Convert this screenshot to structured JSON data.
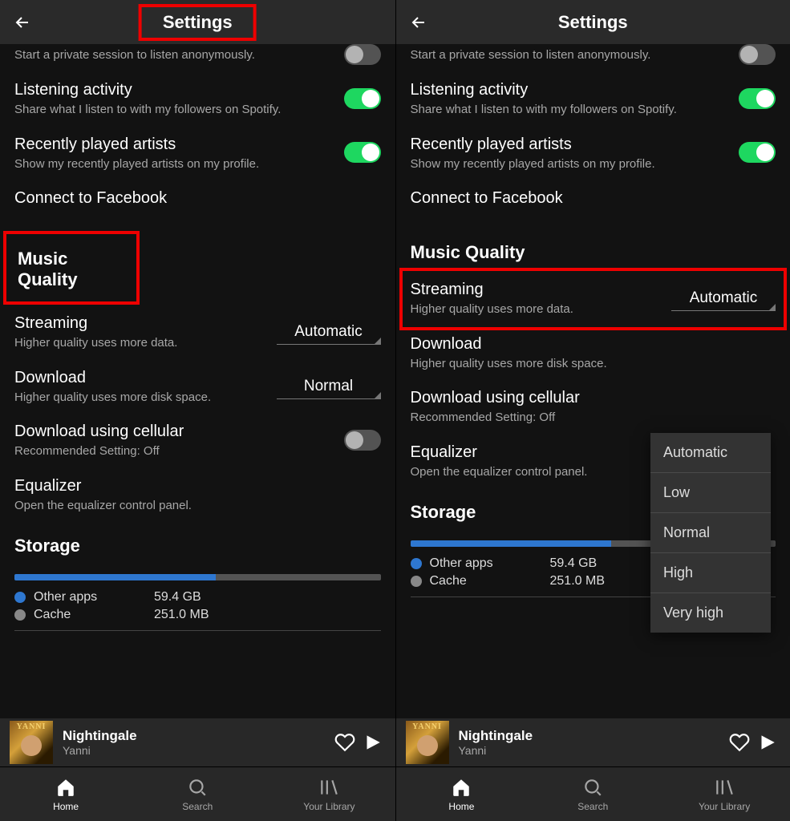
{
  "header": {
    "title": "Settings"
  },
  "settings": {
    "private_session": {
      "sub": "Start a private session to listen anonymously."
    },
    "listening": {
      "title": "Listening activity",
      "sub": "Share what I listen to with my followers on Spotify."
    },
    "recent": {
      "title": "Recently played artists",
      "sub": "Show my recently played artists on my profile."
    },
    "facebook": {
      "title": "Connect to Facebook"
    },
    "section_music": "Music Quality",
    "streaming": {
      "title": "Streaming",
      "sub": "Higher quality uses more data.",
      "value": "Automatic"
    },
    "download": {
      "title": "Download",
      "sub": "Higher quality uses more disk space.",
      "value": "Normal"
    },
    "cellular": {
      "title": "Download using cellular",
      "sub": "Recommended Setting: Off"
    },
    "equalizer": {
      "title": "Equalizer",
      "sub": "Open the equalizer control panel."
    },
    "section_storage": "Storage",
    "storage": {
      "other_label": "Other apps",
      "other_value": "59.4 GB",
      "cache_label": "Cache",
      "cache_value": "251.0 MB"
    }
  },
  "quality_options": [
    "Automatic",
    "Low",
    "Normal",
    "High",
    "Very high"
  ],
  "nowplaying": {
    "title": "Nightingale",
    "artist": "Yanni"
  },
  "nav": {
    "home": "Home",
    "search": "Search",
    "library": "Your Library"
  }
}
